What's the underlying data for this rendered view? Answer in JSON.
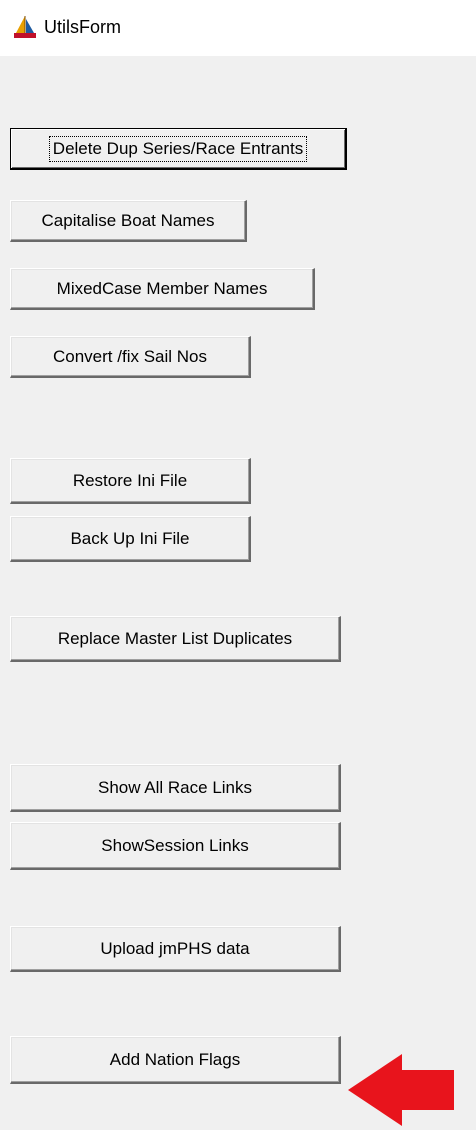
{
  "window": {
    "title": "UtilsForm",
    "icon": "sailboat-icon"
  },
  "buttons": {
    "delete_dup": "Delete Dup Series/Race Entrants",
    "capitalise": "Capitalise Boat Names",
    "mixedcase": "MixedCase Member Names",
    "convert_sail": "Convert /fix Sail Nos",
    "restore_ini": "Restore Ini File",
    "backup_ini": "Back Up Ini File",
    "replace_master": "Replace Master List Duplicates",
    "show_race_links": "Show All Race Links",
    "show_session_links": "ShowSession Links",
    "upload_jmphs": "Upload jmPHS data",
    "add_nation_flags": "Add Nation Flags"
  },
  "annotation": {
    "arrow_color": "#e8141c",
    "arrow_icon": "red-arrow-left-icon"
  }
}
